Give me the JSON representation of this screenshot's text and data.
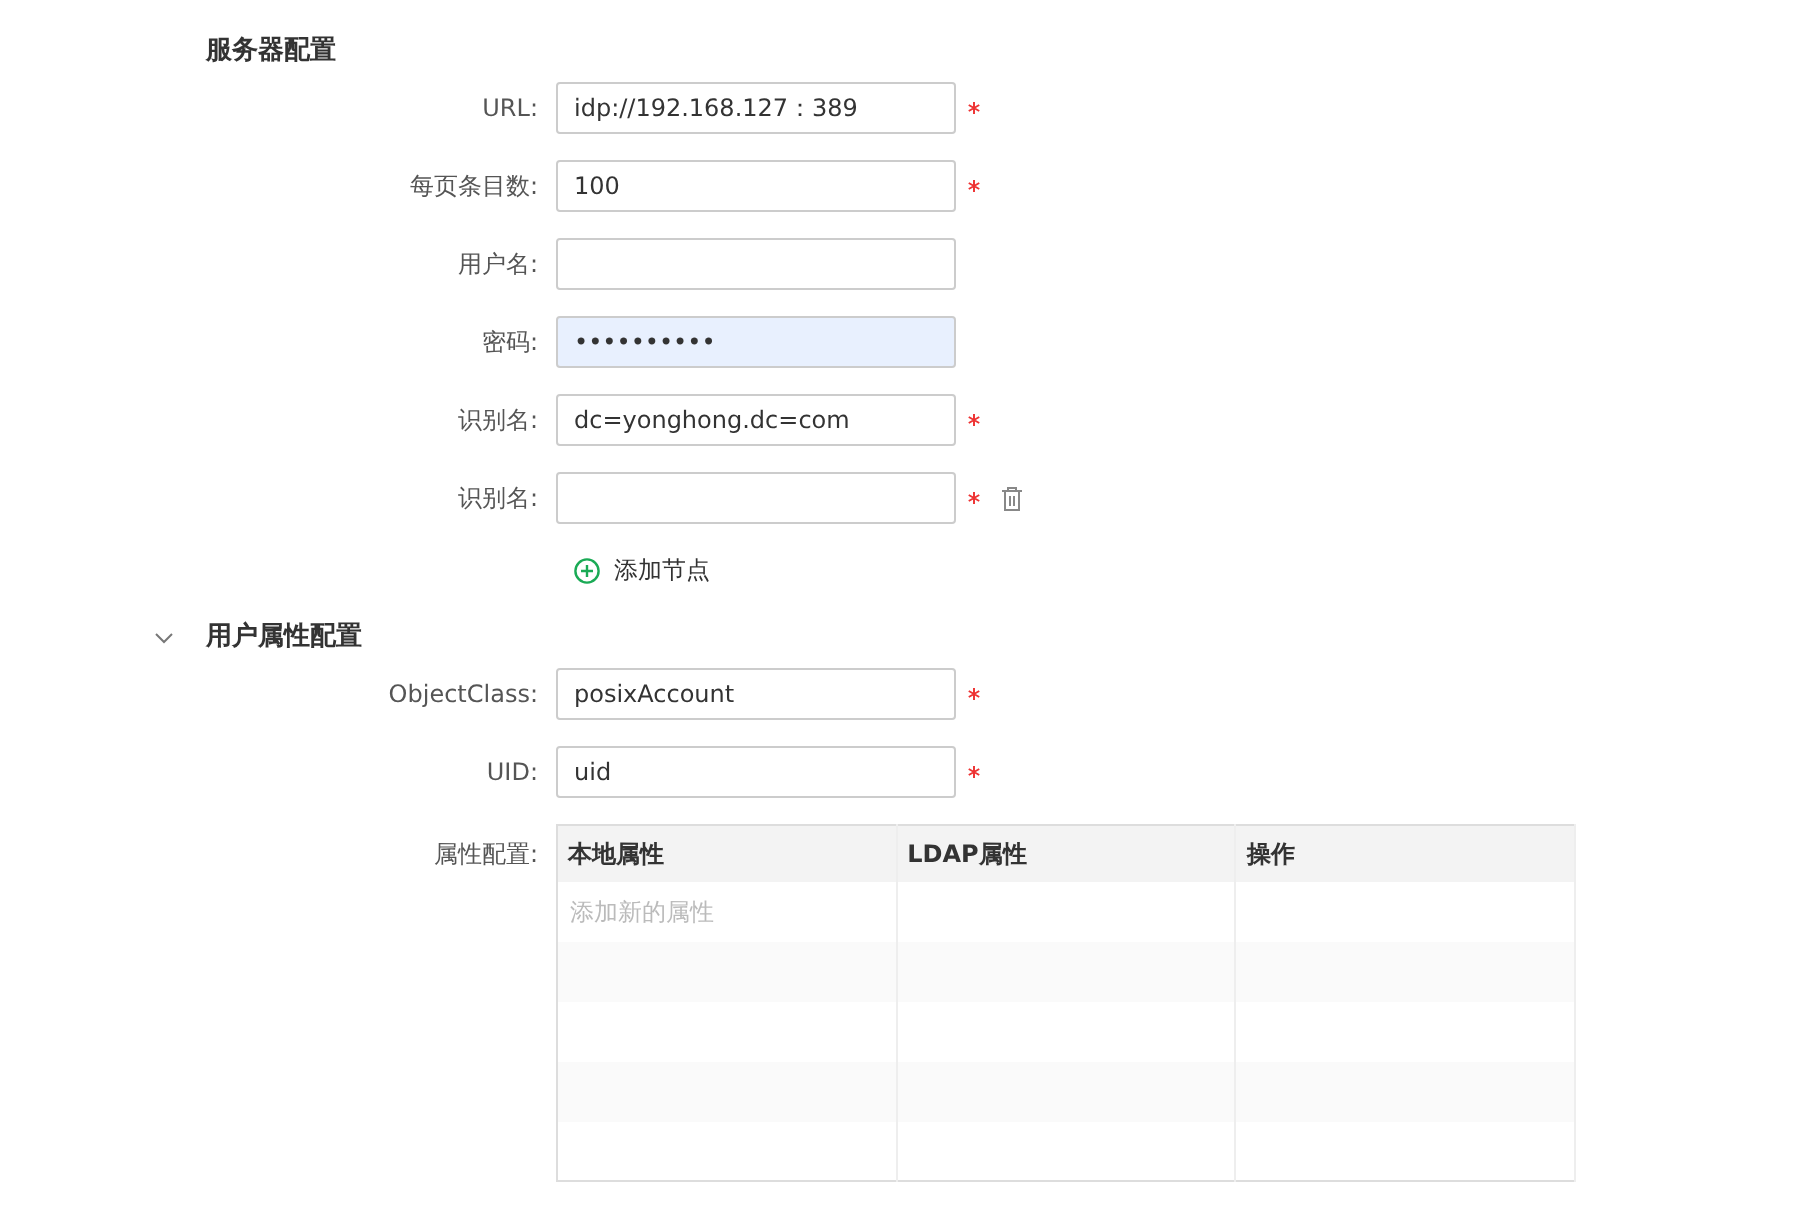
{
  "sections": [
    {
      "title": "服务器配置",
      "fields": [
        {
          "label": "URL:",
          "value": "idp://192.168.127：389",
          "required": true,
          "autofilled": false,
          "removable": false
        },
        {
          "label": "每页条目数:",
          "value": "100",
          "required": true,
          "autofilled": false,
          "removable": false
        },
        {
          "label": "用户名:",
          "required": false,
          "autofilled": false,
          "removable": false
        },
        {
          "label": "密码:",
          "value": "••••••••••",
          "required": false,
          "autofilled": true,
          "removable": false
        },
        {
          "label": "识别名:",
          "value": "dc=yonghong.dc=com",
          "required": true,
          "autofilled": false,
          "removable": false
        },
        {
          "label": "识别名:",
          "required": true,
          "autofilled": false,
          "removable": true
        }
      ],
      "add_link": "添加节点"
    },
    {
      "title": "用户属性配置",
      "expanded": true,
      "fields": [
        {
          "label": "ObjectClass:",
          "value": "posixAccount",
          "required": true,
          "autofilled": false,
          "removable": false
        },
        {
          "label": "UID:",
          "value": "uid",
          "required": true,
          "autofilled": false,
          "removable": false
        }
      ],
      "table": {
        "label": "属性配置:",
        "columns": [
          "本地属性",
          "LDAP属性",
          "操作"
        ],
        "placeholder": "添加新的属性"
      }
    }
  ]
}
